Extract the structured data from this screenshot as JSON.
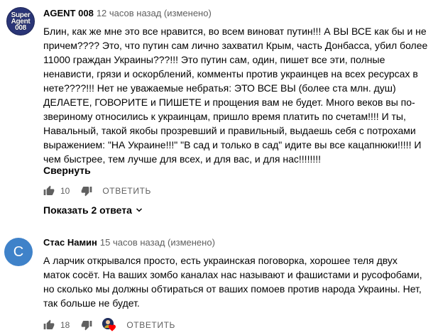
{
  "comments": [
    {
      "author": "AGENT 008",
      "time": "12 часов назад (изменено)",
      "avatar_text": [
        "Super",
        "Agent",
        "008"
      ],
      "lines": [
        "Блин, как же мне это все нравится, во всем виноват путин!!! А ВЫ ВСЕ как бы и не",
        "причем???? Это, что путин сам лично захватил Крым, часть Донбасса, убил более",
        "11000 граждан Украины???!!! Это путин сам, один, пишет все эти, полные",
        "ненависти,  грязи и оскорблений, комменты против украинцев на всех ресурсах в",
        "нете????!!! Нет не уважаемые небратья: ЭТО ВСЕ ВЫ (более ста млн. душ)",
        "ДЕЛАЕТЕ,  ГОВОРИТЕ и ПИШЕТЕ и прощения вам не будет. Много веков вы по-",
        "звериному относились к украинцам, пришло время платить по счетам!!!! И ты,",
        "Навальный, такой якобы прозревший и правильный, выдаешь себя с потрохами",
        "выражением: \"НА Украине!!!\" \"В сад и только в сад\" идите вы все кацапнюки!!!!! И",
        "чем быстрее, тем лучше для всех, и для вас, и для нас!!!!!!!!"
      ],
      "collapse_label": "Свернуть",
      "likes": "10",
      "reply_label": "ОТВЕТИТЬ",
      "show_replies_label": "Показать 2 ответа"
    },
    {
      "author": "Стас Намин",
      "time": "15 часов назад (изменено)",
      "avatar_letter": "С",
      "lines": [
        "А ларчик открывался просто, есть украинская поговорка, хорошее теля двух",
        "маток сосёт. На ваших зомбо каналах нас называют и фашистами и русофобами,",
        "но сколько мы должны обтираться от ваших помоев против народа Украины. Нет,",
        "так больше не будет."
      ],
      "likes": "18",
      "reply_label": "ОТВЕТИТЬ"
    }
  ],
  "colors": {
    "text": "#030303",
    "secondary": "#606060",
    "avatar_blue": "#3f82c9",
    "heart": "#ff0000"
  }
}
